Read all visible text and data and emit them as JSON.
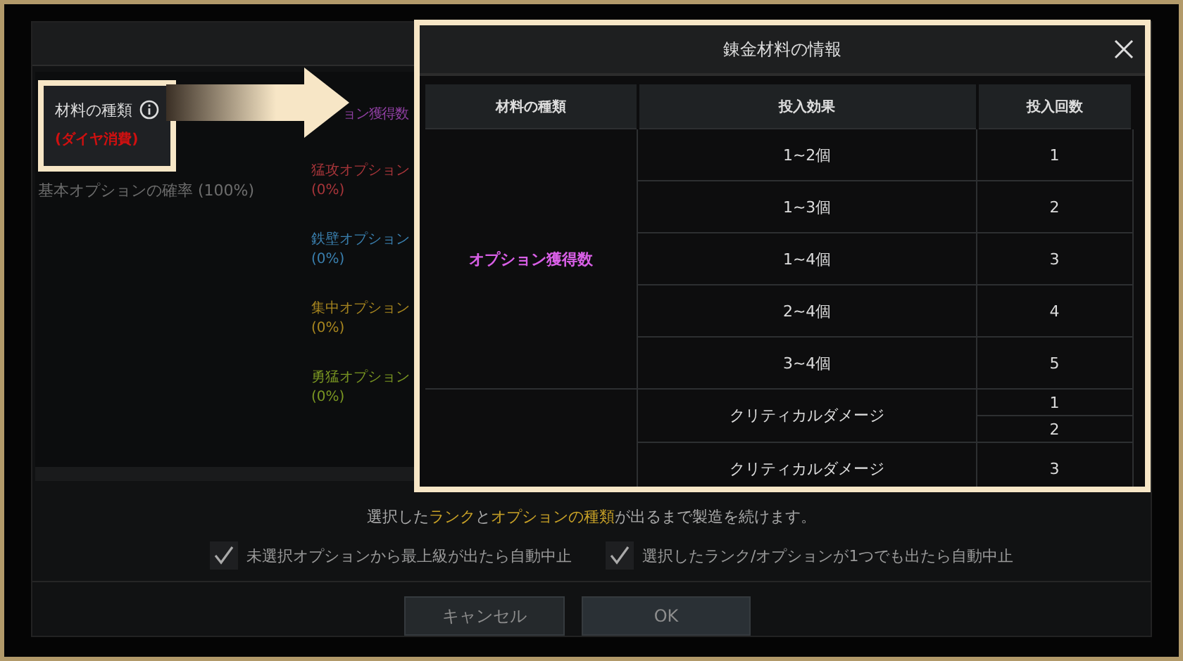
{
  "left_panel": {
    "label": "材料の種類",
    "cost_note": "(ダイヤ消費)",
    "base_option": "基本オプションの確率 (100%)"
  },
  "options": [
    {
      "name": "ョン獲得数",
      "color": "#8e3fa0"
    },
    {
      "name": "猛攻オプション",
      "percent": "(0%)",
      "color": "#a8353a"
    },
    {
      "name": "鉄壁オプション",
      "percent": "(0%)",
      "color": "#3a7fae"
    },
    {
      "name": "集中オプション",
      "percent": "(0%)",
      "color": "#a8861f"
    },
    {
      "name": "勇猛オプション",
      "percent": "(0%)",
      "color": "#7a9622"
    }
  ],
  "notice": [
    {
      "text": "選択した",
      "highlight": false
    },
    {
      "text": "ランク",
      "highlight": true
    },
    {
      "text": "と",
      "highlight": false
    },
    {
      "text": "オプションの種類",
      "highlight": true
    },
    {
      "text": "が出るまで製造を続けます。",
      "highlight": false
    }
  ],
  "checkboxes": [
    {
      "label": "未選択オプションから最上級が出たら自動中止",
      "checked": true
    },
    {
      "label": "選択したランク/オプションが1つでも出たら自動中止",
      "checked": true
    }
  ],
  "buttons": [
    {
      "label": "キャンセル"
    },
    {
      "label": "OK"
    }
  ],
  "popup": {
    "title": "錬金材料の情報",
    "columns": [
      "材料の種類",
      "投入効果",
      "投入回数"
    ],
    "groups": [
      {
        "material": "オプション獲得数",
        "rows": [
          {
            "effect": "1~2個",
            "counts": [
              "1"
            ]
          },
          {
            "effect": "1~3個",
            "counts": [
              "2"
            ]
          },
          {
            "effect": "1~4個",
            "counts": [
              "3"
            ]
          },
          {
            "effect": "2~4個",
            "counts": [
              "4"
            ]
          },
          {
            "effect": "3~4個",
            "counts": [
              "5"
            ]
          }
        ]
      },
      {
        "rows": [
          {
            "effect": "クリティカルダメージ",
            "counts": [
              "1",
              "2"
            ]
          },
          {
            "effect": "クリティカルダメージ",
            "counts": [
              "3"
            ]
          }
        ]
      }
    ]
  }
}
